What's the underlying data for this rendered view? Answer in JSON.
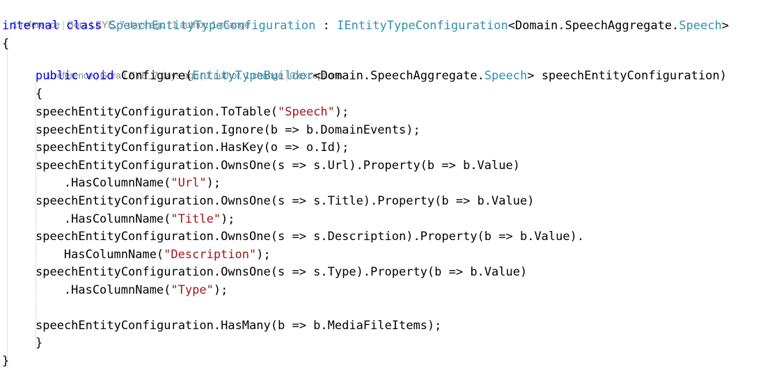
{
  "editor": {
    "background": "#ffffff",
    "colors": {
      "keyword": "#0000FF",
      "type": "#2B91AF",
      "string": "#A31515",
      "plain": "#000000",
      "codelens_text": "#848484",
      "indent_guide": "#BFBFBF"
    }
  },
  "codelens": [
    {
      "id": "class-codelens",
      "segments": [
        "1 reference",
        "Gora LEYE, 7 days ago",
        "1 author, 1 change"
      ],
      "separator": "|"
    },
    {
      "id": "method-codelens",
      "segments": [
        "1 reference",
        "Gora LEYE, 7 days ago",
        "1 author, 1 change",
        "0 exceptions"
      ],
      "separator": "|"
    }
  ],
  "code": {
    "class_declaration": {
      "kw_internal": "internal",
      "kw_class": "class",
      "type_name": "SpeechEntityTypeConfiguration",
      "colon": " : ",
      "interface_name": "IEntityTypeConfiguration",
      "generic_open": "<",
      "generic_namespace": "Domain.SpeechAggregate.",
      "generic_type": "Speech",
      "generic_close": ">"
    },
    "class_open_brace": "{",
    "method_signature": {
      "kw_public": "public",
      "kw_void": "void",
      "name": "Configure",
      "paren_open": "(",
      "param_type": "EntityTypeBuilder",
      "generic_open": "<",
      "generic_namespace": "Domain.SpeechAggregate.",
      "generic_type": "Speech",
      "generic_close": ">",
      "param_name": " speechEntityConfiguration",
      "paren_close": ")"
    },
    "method_open_brace": "{",
    "statements": [
      {
        "indent": 8,
        "before": "speechEntityConfiguration.ToTable(",
        "string": "\"Speech\"",
        "after": ");"
      },
      {
        "indent": 8,
        "before": "speechEntityConfiguration.Ignore(b => b.DomainEvents);",
        "string": "",
        "after": ""
      },
      {
        "indent": 8,
        "before": "speechEntityConfiguration.HasKey(o => o.Id);",
        "string": "",
        "after": ""
      },
      {
        "indent": 8,
        "before": "speechEntityConfiguration.OwnsOne(s => s.Url).Property(b => b.Value)",
        "string": "",
        "after": ""
      },
      {
        "indent": 12,
        "before": ".HasColumnName(",
        "string": "\"Url\"",
        "after": ");"
      },
      {
        "indent": 8,
        "before": "speechEntityConfiguration.OwnsOne(s => s.Title).Property(b => b.Value)",
        "string": "",
        "after": ""
      },
      {
        "indent": 12,
        "before": ".HasColumnName(",
        "string": "\"Title\"",
        "after": ");"
      },
      {
        "indent": 8,
        "before": "speechEntityConfiguration.OwnsOne(s => s.Description).Property(b => b.Value).",
        "string": "",
        "after": ""
      },
      {
        "indent": 12,
        "before": "HasColumnName(",
        "string": "\"Description\"",
        "after": ");"
      },
      {
        "indent": 8,
        "before": "speechEntityConfiguration.OwnsOne(s => s.Type).Property(b => b.Value)",
        "string": "",
        "after": ""
      },
      {
        "indent": 12,
        "before": ".HasColumnName(",
        "string": "\"Type\"",
        "after": ");"
      },
      {
        "indent": 8,
        "before": "",
        "string": "",
        "after": ""
      },
      {
        "indent": 8,
        "before": "speechEntityConfiguration.HasMany(b => b.MediaFileItems);",
        "string": "",
        "after": ""
      }
    ],
    "method_close_brace": "}",
    "class_close_brace": "}"
  }
}
